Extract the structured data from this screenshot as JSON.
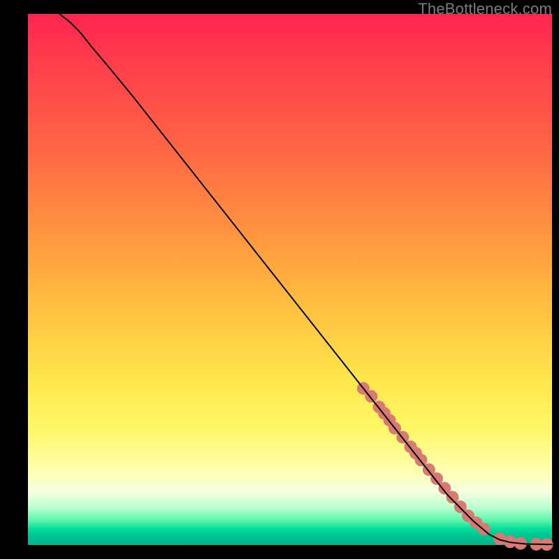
{
  "watermark": "TheBottleneck.com",
  "chart_data": {
    "type": "line",
    "title": "",
    "xlabel": "",
    "ylabel": "",
    "xlim": [
      0,
      100
    ],
    "ylim": [
      0,
      100
    ],
    "grid": false,
    "legend": false,
    "series": [
      {
        "name": "curve",
        "style": "line",
        "color": "#000000",
        "x": [
          6,
          8,
          10,
          12,
          15,
          20,
          30,
          40,
          50,
          60,
          70,
          80,
          85,
          88,
          90,
          92,
          95,
          100
        ],
        "y": [
          100,
          98.5,
          96.5,
          94,
          90.5,
          84.5,
          72,
          59.5,
          47,
          34.5,
          22,
          9.5,
          4.5,
          2,
          1,
          0.5,
          0.2,
          0.1
        ]
      },
      {
        "name": "dots",
        "style": "scatter",
        "color": "#d87a72",
        "radius": 9,
        "x": [
          64,
          65.5,
          67,
          68,
          69,
          70,
          71.5,
          73,
          74,
          75,
          76.5,
          78,
          79.5,
          81,
          82.5,
          84,
          85.5,
          87,
          90,
          92,
          94,
          97,
          99
        ],
        "y": [
          29.5,
          28,
          26,
          24.8,
          23.5,
          22,
          20.3,
          18.5,
          17.3,
          16,
          14.2,
          12.5,
          10.7,
          9,
          7.2,
          5.5,
          4.2,
          3,
          1.2,
          0.6,
          0.3,
          0.15,
          0.1
        ]
      }
    ],
    "background_gradient": {
      "direction": "vertical",
      "stops": [
        {
          "pos": 0.0,
          "color": "#ff2550"
        },
        {
          "pos": 0.25,
          "color": "#ff6545"
        },
        {
          "pos": 0.55,
          "color": "#ffbf3f"
        },
        {
          "pos": 0.78,
          "color": "#fff765"
        },
        {
          "pos": 0.9,
          "color": "#f6ffe0"
        },
        {
          "pos": 0.96,
          "color": "#57f3a8"
        },
        {
          "pos": 1.0,
          "color": "#00b38b"
        }
      ]
    }
  }
}
